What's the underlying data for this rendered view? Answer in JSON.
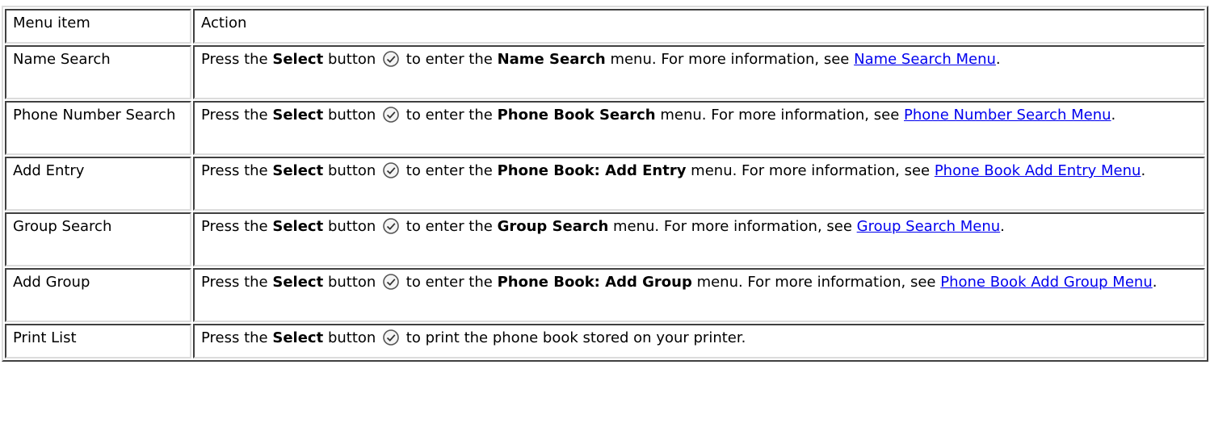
{
  "header": {
    "col1": "Menu item",
    "col2": "Action"
  },
  "common": {
    "press": "Press the",
    "select": "Select",
    "button": "button",
    "to_enter_the": "to enter the",
    "menu_more": "menu. For more information, see",
    "period": ".",
    "icon": "select-checkmark-icon"
  },
  "rows": [
    {
      "item": "Name Search",
      "menu": "Name Search",
      "link": "Name Search Menu"
    },
    {
      "item": "Phone Number Search",
      "menu": "Phone Book Search",
      "link": "Phone Number Search Menu"
    },
    {
      "item": "Add Entry",
      "menu": "Phone Book: Add Entry",
      "link": "Phone Book Add Entry Menu"
    },
    {
      "item": "Group Search",
      "menu": "Group Search",
      "link": "Group Search Menu"
    },
    {
      "item": "Add Group",
      "menu": "Phone Book: Add Group",
      "link": "Phone Book Add Group Menu"
    },
    {
      "item": "Print List",
      "action_tail": "to print the phone book stored on your printer."
    }
  ]
}
